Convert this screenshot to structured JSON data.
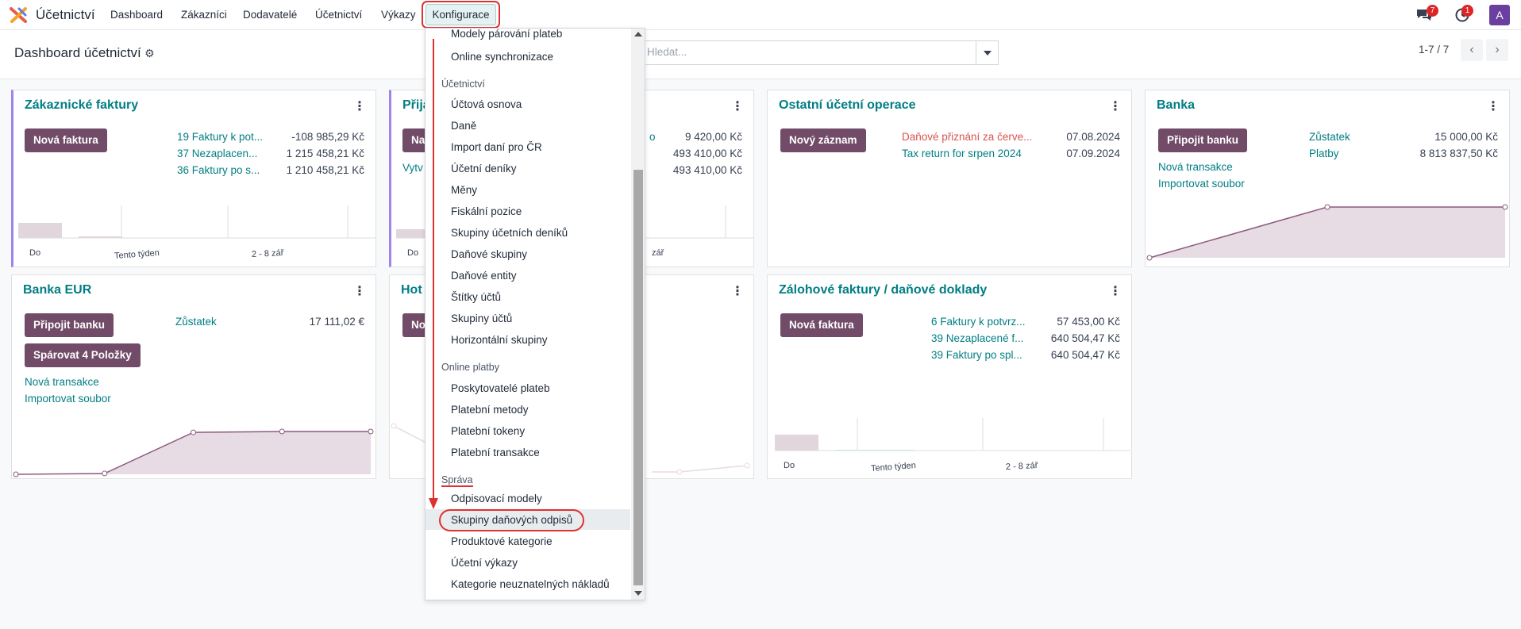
{
  "app": {
    "name": "Účetnictví"
  },
  "nav": {
    "items": [
      "Dashboard",
      "Zákazníci",
      "Dodavatelé",
      "Účetnictví",
      "Výkazy"
    ],
    "active": "Konfigurace",
    "chat_badge": "7",
    "activity_badge": "1",
    "avatar": "A"
  },
  "control": {
    "title": "Dashboard účetnictví",
    "search_placeholder": "Hledat...",
    "pager": "1-7 / 7"
  },
  "cards": {
    "c1": {
      "title": "Zákaznické faktury",
      "button": "Nová faktura",
      "rows": [
        {
          "label": "19 Faktury k pot...",
          "amount": "-108 985,29 Kč"
        },
        {
          "label": "37 Nezaplacen...",
          "amount": "1 215 458,21 Kč"
        },
        {
          "label": "36 Faktury po s...",
          "amount": "1 210 458,21 Kč"
        }
      ],
      "graph_labels": [
        "Do",
        "Tento týden",
        "2 - 8 zář"
      ]
    },
    "c2": {
      "title_fragment": "Přija",
      "button_fragment": "Na",
      "link_fragment": "Vytv",
      "link_right": "o",
      "amounts": [
        "9 420,00 Kč",
        "493 410,00 Kč",
        "493 410,00 Kč"
      ],
      "graph_labels": [
        "Do",
        "zář"
      ]
    },
    "c3": {
      "title": "Ostatní účetní operace",
      "button": "Nový záznam",
      "rows": [
        {
          "label": "Daňové přiznání za červe...",
          "date": "07.08.2024"
        },
        {
          "label": "Tax return for srpen 2024",
          "date": "07.09.2024"
        }
      ]
    },
    "c4": {
      "title": "Banka",
      "button": "Připojit banku",
      "rows": [
        {
          "label": "Zůstatek",
          "amount": "15 000,00 Kč"
        },
        {
          "label": "Platby",
          "amount": "8 813 837,50 Kč"
        }
      ],
      "links": [
        "Nová transakce",
        "Importovat soubor"
      ],
      "chart_data": {
        "type": "area",
        "values": [
          0,
          1,
          1
        ]
      }
    },
    "c5": {
      "title": "Banka EUR",
      "button1": "Připojit banku",
      "button2": "Spárovat 4 Položky",
      "balance_label": "Zůstatek",
      "balance": "17 111,02 €",
      "links": [
        "Nová transakce",
        "Importovat soubor"
      ],
      "chart_data": {
        "type": "area",
        "values": [
          0,
          0.02,
          0.98,
          1,
          1
        ]
      }
    },
    "c6": {
      "title_fragment": "Hot",
      "button_fragment": "No"
    },
    "c7": {
      "title": "Zálohové faktury / daňové doklady",
      "button": "Nová faktura",
      "rows": [
        {
          "label": "6 Faktury k potvrz...",
          "amount": "57 453,00 Kč"
        },
        {
          "label": "39 Nezaplacené f...",
          "amount": "640 504,47 Kč"
        },
        {
          "label": "39 Faktury po spl...",
          "amount": "640 504,47 Kč"
        }
      ],
      "graph_labels": [
        "Do",
        "Tento týden",
        "2 - 8 zář"
      ]
    }
  },
  "menu": {
    "top_items": [
      "Modely párování plateb",
      "Online synchronizace"
    ],
    "sections": [
      {
        "header": "Účetnictví",
        "items": [
          "Účtová osnova",
          "Daně",
          "Import daní pro ČR",
          "Účetní deníky",
          "Měny",
          "Fiskální pozice",
          "Skupiny účetních deníků",
          "Daňové skupiny",
          "Daňové entity",
          "Štítky účtů",
          "Skupiny účtů",
          "Horizontální skupiny"
        ]
      },
      {
        "header": "Online platby",
        "items": [
          "Poskytovatelé plateb",
          "Platební metody",
          "Platební tokeny",
          "Platební transakce"
        ]
      },
      {
        "header": "Správa",
        "items": [
          "Odpisovací modely",
          "Skupiny daňových odpisů",
          "Produktové kategorie",
          "Účetní výkazy",
          "Kategorie neuznatelných nákladů"
        ]
      }
    ],
    "highlighted": "Skupiny daňových odpisů"
  },
  "colors": {
    "brand": "#714b67",
    "link": "#017e84",
    "accent_outline": "#e03131"
  }
}
